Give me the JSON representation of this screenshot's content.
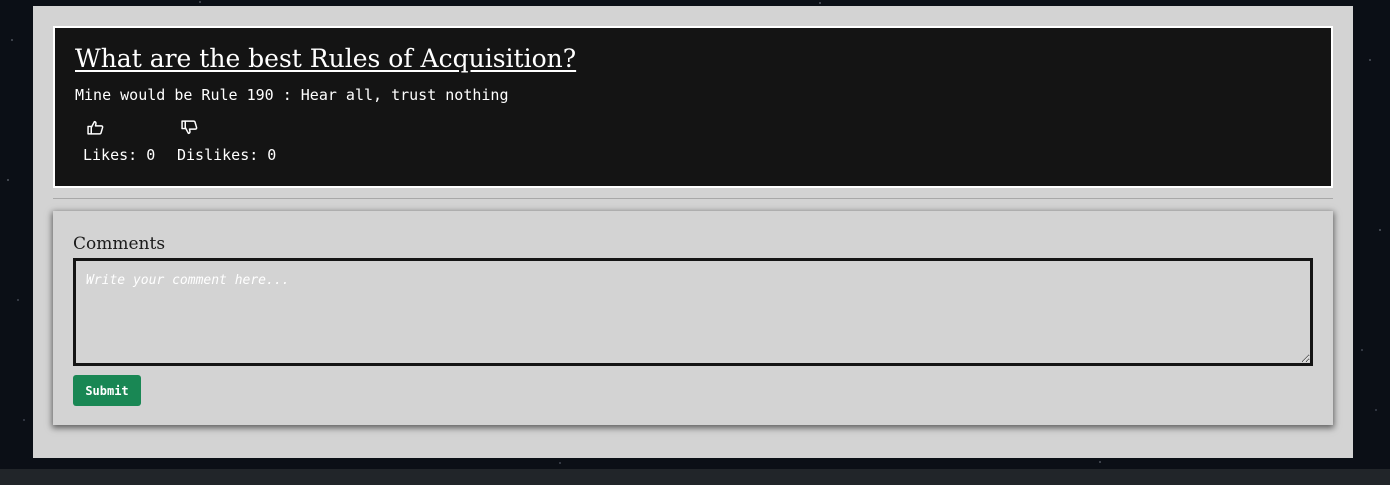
{
  "post": {
    "title": "What are the best Rules of Acquisition?",
    "body": "Mine would be Rule 190 : Hear all, trust nothing",
    "likes_text": "Likes: 0",
    "dislikes_text": "Dislikes: 0",
    "like_icon": "thumbs-up-icon",
    "dislike_icon": "thumbs-down-icon"
  },
  "comments": {
    "label": "Comments",
    "placeholder": "Write your comment here...",
    "value": "",
    "submit_label": "Submit"
  },
  "colors": {
    "post_background": "#141414",
    "panel_background": "#d3d3d3",
    "submit_button": "#198754",
    "footer": "#212529"
  }
}
